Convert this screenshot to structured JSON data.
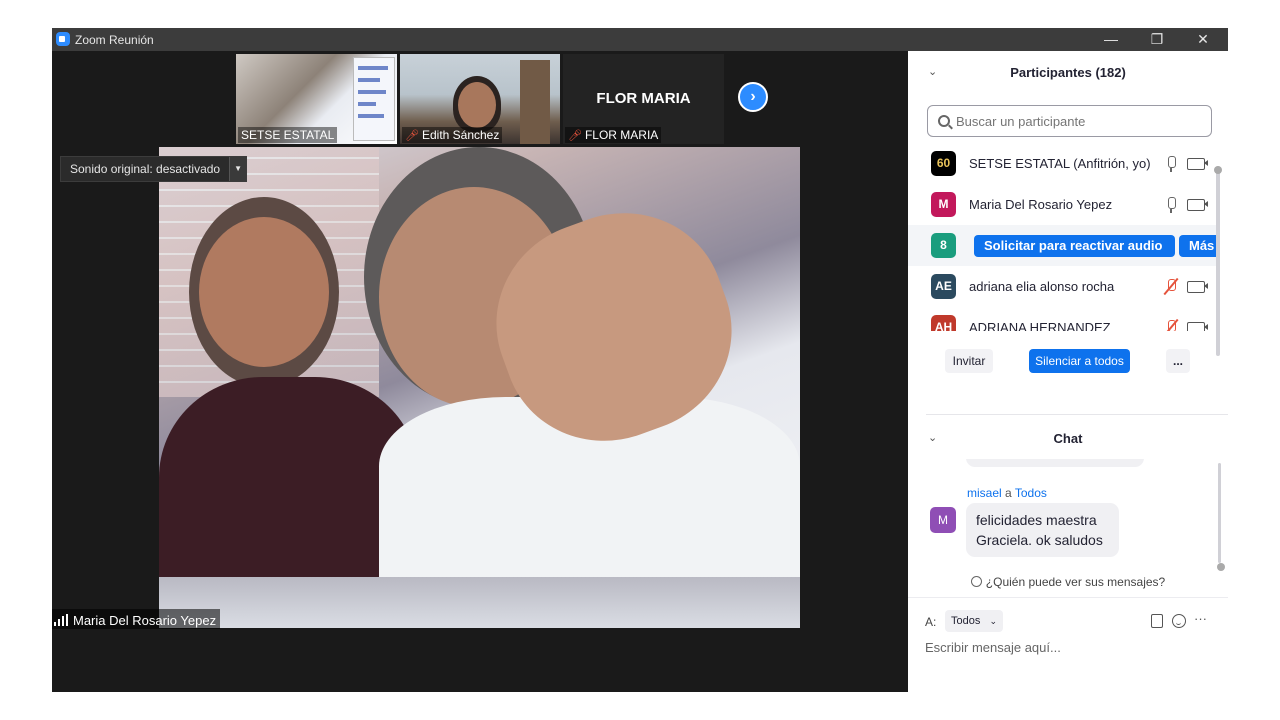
{
  "window": {
    "title": "Zoom Reunión",
    "minimize_icon": "—",
    "maximize_icon": "❐",
    "close_icon": "✕"
  },
  "thumbnails": [
    {
      "name": "SETSE ESTATAL",
      "muted": false
    },
    {
      "name": "Edith Sánchez",
      "muted": true
    },
    {
      "name": "FLOR MARIA",
      "muted": true,
      "display_name": "FLOR MARIA"
    }
  ],
  "next_page_icon": "›",
  "sound_control": {
    "label": "Sonido original: desactivado",
    "dropdown_icon": "▼"
  },
  "active_speaker": "Maria Del Rosario Yepez",
  "participants_panel": {
    "title": "Participantes (182)",
    "chevron": "⌄",
    "search_placeholder": "Buscar un participante",
    "participants": [
      {
        "avatar": "60",
        "avatar_color": "#000000",
        "name": "SETSE ESTATAL (Anfitrión, yo)",
        "mic": "on"
      },
      {
        "avatar": "M",
        "avatar_color": "#c2185b",
        "name": "Maria Del Rosario Yepez",
        "mic": "on"
      },
      {
        "avatar": "8",
        "avatar_color": "#1a9d7e",
        "request_audio_label": "Solicitar para reactivar audio",
        "more_label": "Más"
      },
      {
        "avatar": "AE",
        "avatar_color": "#2b4a5f",
        "name": "adriana elia alonso rocha",
        "mic": "muted"
      },
      {
        "avatar": "AH",
        "avatar_color": "#c0392b",
        "name": "ADRIANA HERNANDEZ",
        "mic": "muted"
      }
    ],
    "invite_label": "Invitar",
    "mute_all_label": "Silenciar a todos",
    "more_label": "..."
  },
  "chat_panel": {
    "title": "Chat",
    "chevron": "⌄",
    "message": {
      "sender": "misael",
      "to_word": "a",
      "recipient": "Todos",
      "avatar": "M",
      "text_line1": "felicidades maestra",
      "text_line2": "Graciela. ok saludos"
    },
    "who_can_see": "¿Quién puede ver sus mensajes?",
    "to_label": "A:",
    "to_value": "Todos",
    "to_chevron": "⌄",
    "compose_more": "···",
    "input_placeholder": "Escribir mensaje aquí..."
  }
}
